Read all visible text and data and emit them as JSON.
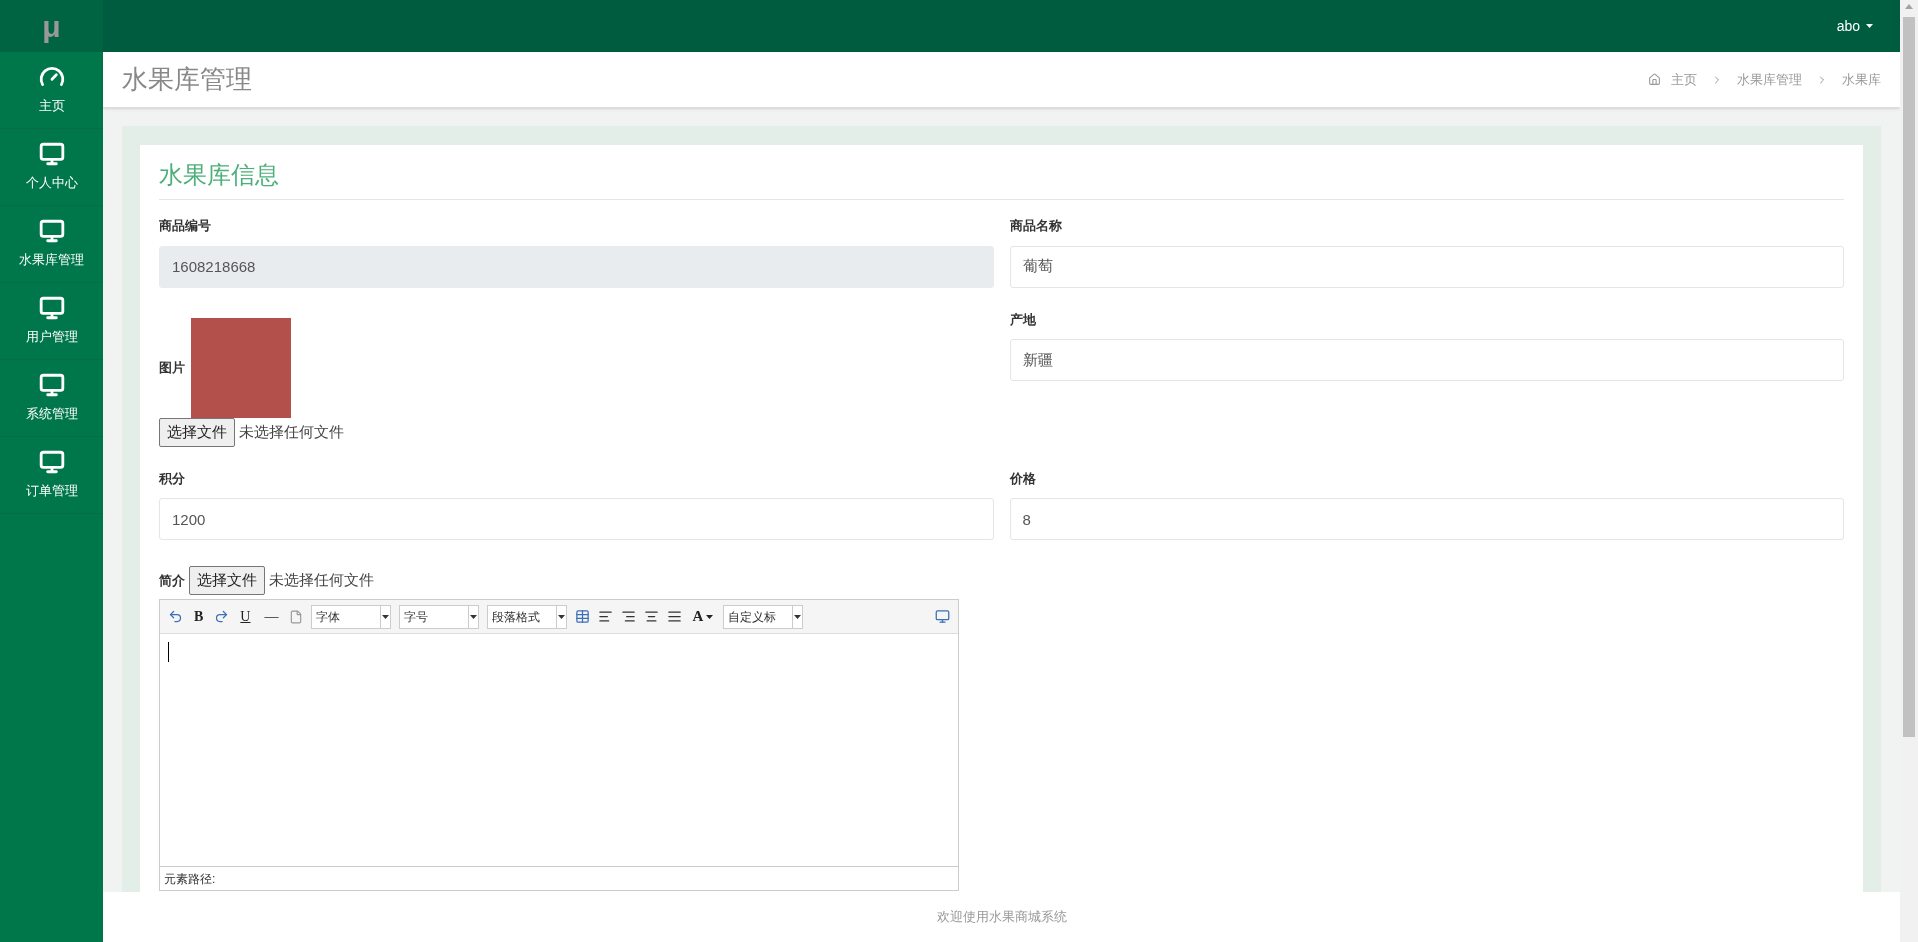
{
  "sidebar": {
    "logo": "μ",
    "items": [
      {
        "label": "主页",
        "kind": "gauge"
      },
      {
        "label": "个人中心",
        "kind": "monitor"
      },
      {
        "label": "水果库管理",
        "kind": "monitor"
      },
      {
        "label": "用户管理",
        "kind": "monitor"
      },
      {
        "label": "系统管理",
        "kind": "monitor"
      },
      {
        "label": "订单管理",
        "kind": "monitor"
      }
    ]
  },
  "topbar": {
    "user": "abo"
  },
  "page": {
    "title": "水果库管理",
    "breadcrumb": [
      "主页",
      "水果库管理",
      "水果库"
    ]
  },
  "form": {
    "title": "水果库信息",
    "rows": [
      [
        {
          "kind": "text",
          "label": "商品编号",
          "value": "1608218668",
          "disabled": true
        },
        {
          "kind": "text",
          "label": "商品名称",
          "value": "葡萄",
          "disabled": false
        }
      ],
      [
        {
          "kind": "image",
          "label": "图片",
          "button": "选择文件",
          "file_status": "未选择任何文件"
        },
        {
          "kind": "text",
          "label": "产地",
          "value": "新疆",
          "disabled": false
        }
      ],
      [
        {
          "kind": "text",
          "label": "积分",
          "value": "1200",
          "disabled": false
        },
        {
          "kind": "text",
          "label": "价格",
          "value": "8",
          "disabled": false
        }
      ]
    ],
    "intro": {
      "label": "简介",
      "button": "选择文件",
      "file_status": "未选择任何文件",
      "toolbar": [
        {
          "kind": "undo"
        },
        {
          "kind": "bold",
          "text": "B"
        },
        {
          "kind": "redo"
        },
        {
          "kind": "underline",
          "text": "U"
        },
        {
          "kind": "rule",
          "text": "—"
        },
        {
          "kind": "page"
        },
        {
          "kind": "select",
          "text": "字体"
        },
        {
          "kind": "select",
          "text": "字号"
        },
        {
          "kind": "select",
          "text": "段落格式"
        },
        {
          "kind": "table"
        },
        {
          "kind": "align-left"
        },
        {
          "kind": "align-right"
        },
        {
          "kind": "align-center"
        },
        {
          "kind": "justify"
        },
        {
          "kind": "color",
          "text": "A"
        },
        {
          "kind": "select",
          "text": "自定义标"
        },
        {
          "kind": "preview"
        }
      ],
      "status": "元素路径:"
    }
  },
  "footer": "欢迎使用水果商城系统"
}
